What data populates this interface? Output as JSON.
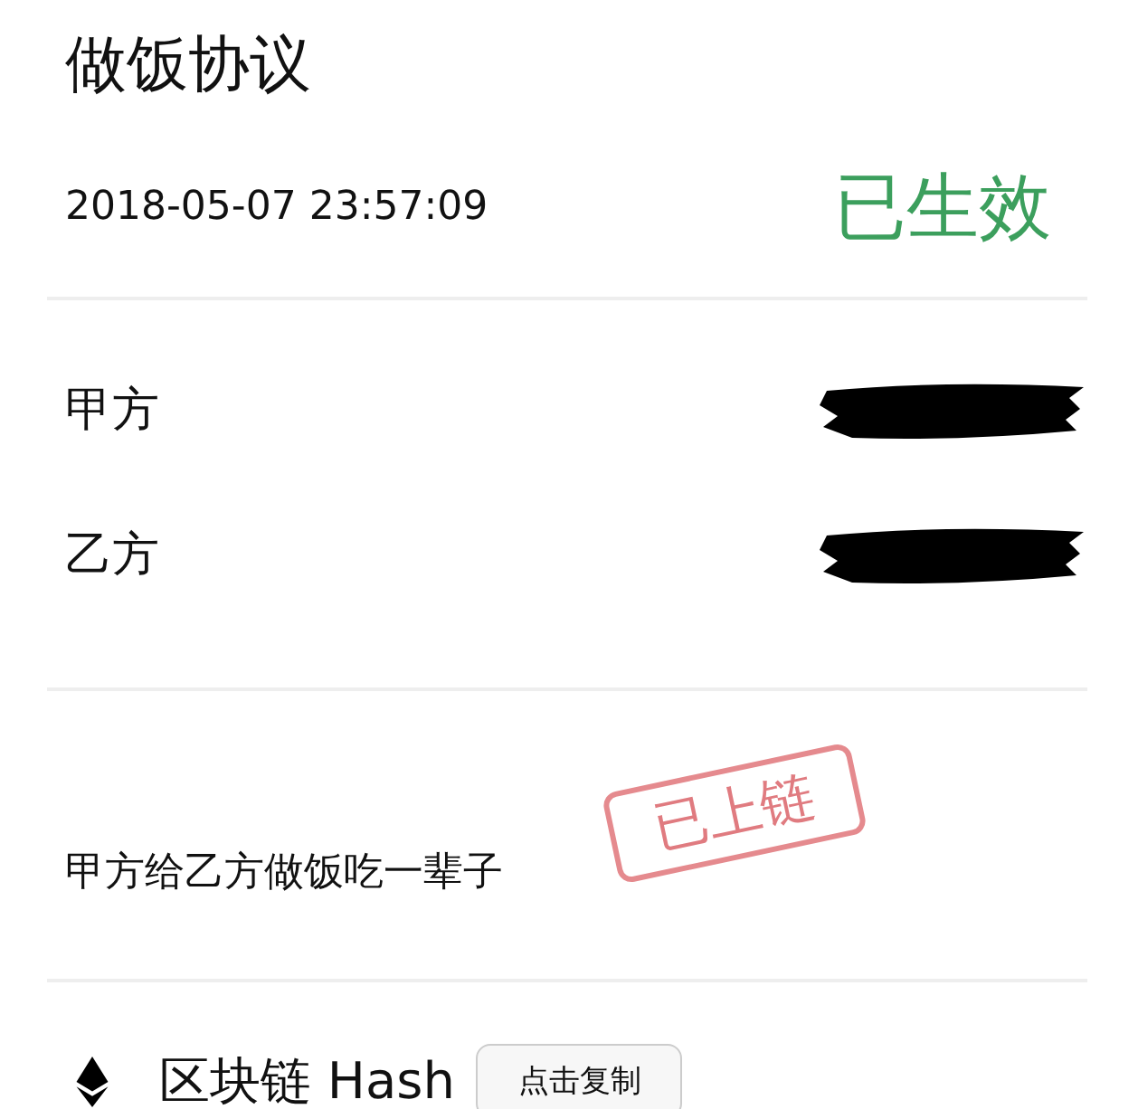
{
  "title": "做饭协议",
  "timestamp": "2018-05-07 23:57:09",
  "status": "已生效",
  "parties": [
    {
      "label": "甲方",
      "redacted": true
    },
    {
      "label": "乙方",
      "redacted": true
    }
  ],
  "content": "甲方给乙方做饭吃一辈子",
  "stamp": "已上链",
  "hash": {
    "label": "区块链 Hash",
    "button": "点击复制"
  }
}
